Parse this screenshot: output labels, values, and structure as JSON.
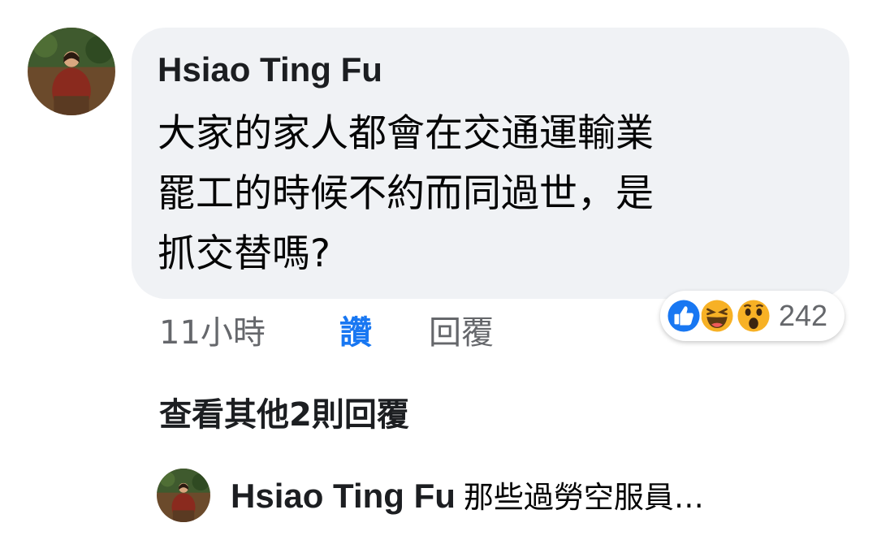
{
  "comment": {
    "author": "Hsiao Ting Fu",
    "text_lines": [
      "大家的家人都會在交通運輸業",
      "罷工的時候不約而同過世，是",
      "抓交替嗎?"
    ],
    "time": "11小時",
    "like_label": "讚",
    "reply_label": "回覆",
    "reactions": {
      "icons": [
        "like-icon",
        "haha-icon",
        "wow-icon"
      ],
      "count": "242",
      "colors": {
        "like": "#1877f2",
        "emoji_face": "#f7b125"
      }
    }
  },
  "view_more_replies": "查看其他2則回覆",
  "reply_preview": {
    "author": "Hsiao Ting Fu",
    "text": "那些過勞空服員…"
  }
}
